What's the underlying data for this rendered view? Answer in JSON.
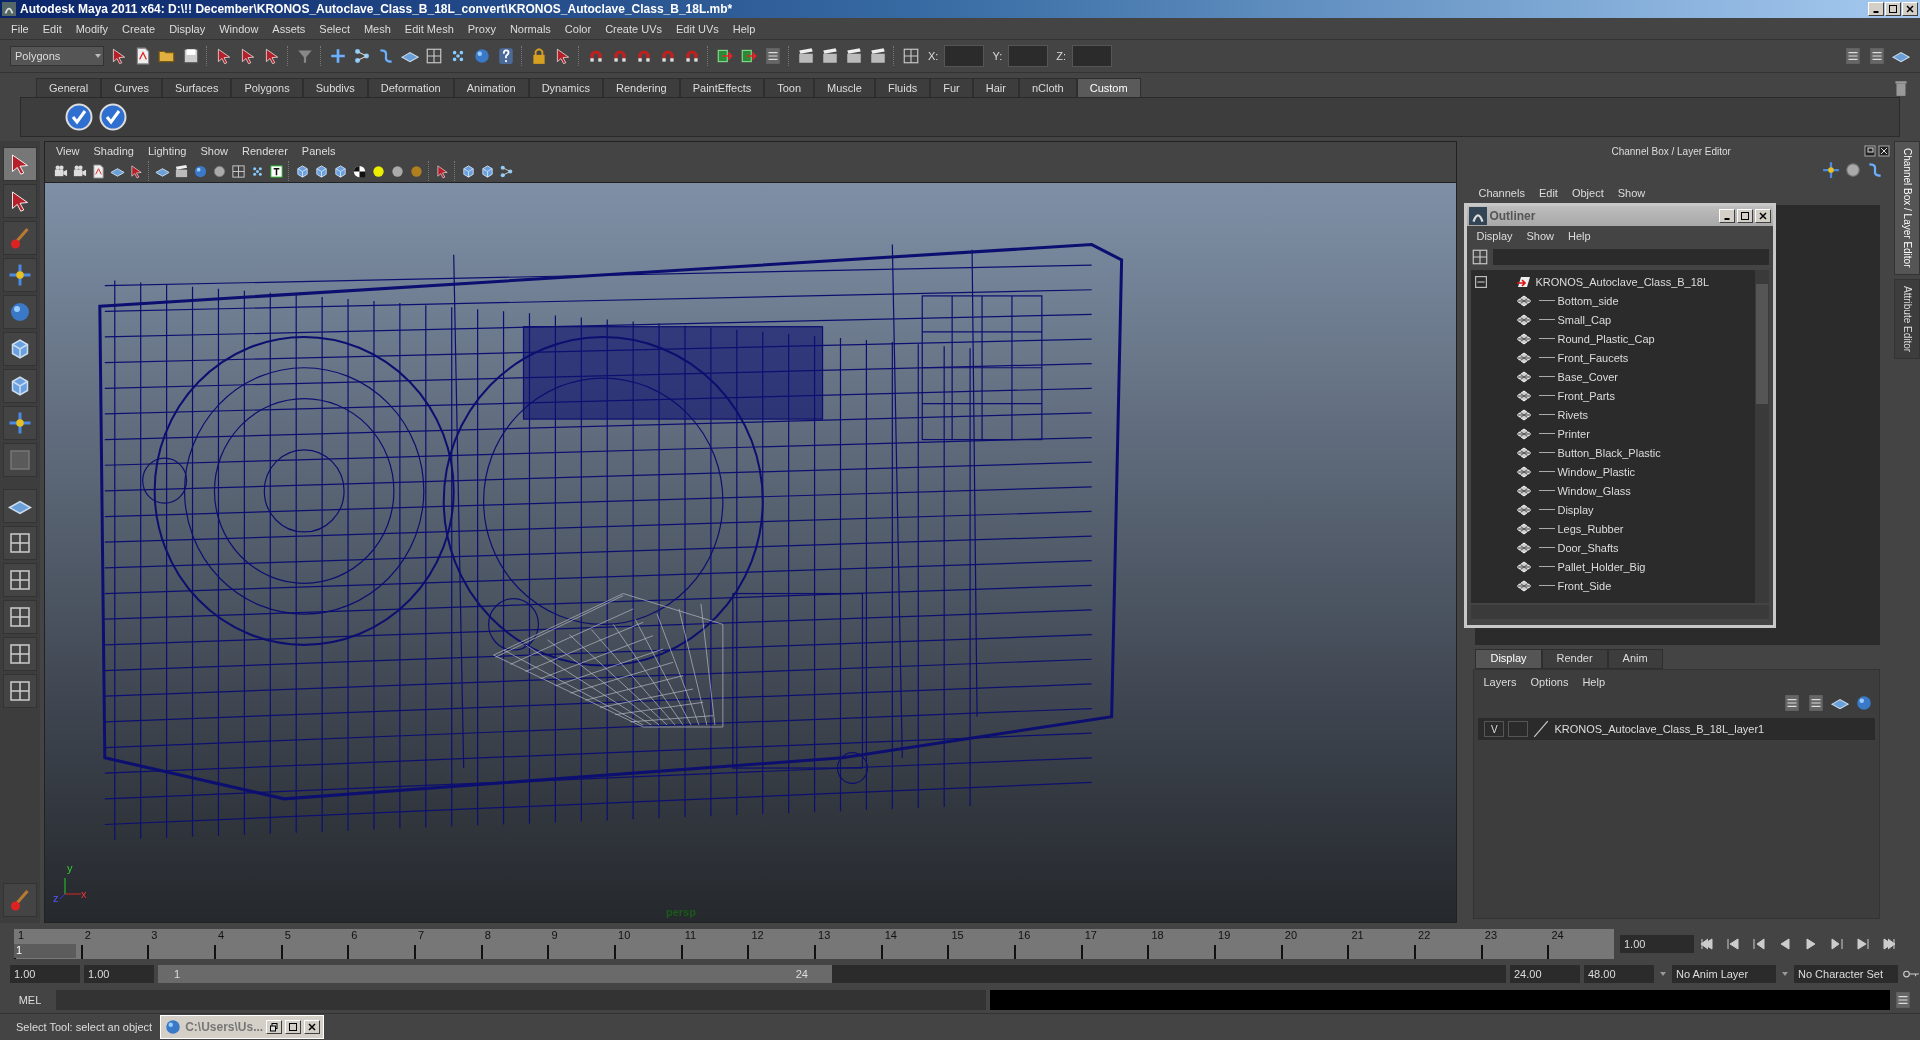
{
  "window": {
    "title": "Autodesk Maya 2011 x64: D:\\!! December\\KRONOS_Autoclave_Class_B_18L_convert\\KRONOS_Autoclave_Class_B_18L.mb*"
  },
  "menu_bar": [
    "File",
    "Edit",
    "Modify",
    "Create",
    "Display",
    "Window",
    "Assets",
    "Select",
    "Mesh",
    "Edit Mesh",
    "Proxy",
    "Normals",
    "Color",
    "Create UVs",
    "Edit UVs",
    "Help"
  ],
  "status_line": {
    "mode": "Polygons",
    "coordinate_labels": [
      "X:",
      "Y:",
      "Z:"
    ]
  },
  "shelf_tabs": [
    {
      "label": "General",
      "selected": false
    },
    {
      "label": "Curves",
      "selected": false
    },
    {
      "label": "Surfaces",
      "selected": false
    },
    {
      "label": "Polygons",
      "selected": false
    },
    {
      "label": "Subdivs",
      "selected": false
    },
    {
      "label": "Deformation",
      "selected": false
    },
    {
      "label": "Animation",
      "selected": false
    },
    {
      "label": "Dynamics",
      "selected": false
    },
    {
      "label": "Rendering",
      "selected": false
    },
    {
      "label": "PaintEffects",
      "selected": false
    },
    {
      "label": "Toon",
      "selected": false
    },
    {
      "label": "Muscle",
      "selected": false
    },
    {
      "label": "Fluids",
      "selected": false
    },
    {
      "label": "Fur",
      "selected": false
    },
    {
      "label": "Hair",
      "selected": false
    },
    {
      "label": "nCloth",
      "selected": false
    },
    {
      "label": "Custom",
      "selected": true
    }
  ],
  "viewport": {
    "menus": [
      "View",
      "Shading",
      "Lighting",
      "Show",
      "Renderer",
      "Panels"
    ],
    "camera": "persp",
    "axis_labels": [
      "y",
      "z",
      "x"
    ]
  },
  "channel_box": {
    "title": "Channel Box / Layer Editor",
    "menus": [
      "Channels",
      "Edit",
      "Object",
      "Show"
    ]
  },
  "side_tabs": [
    {
      "label": "Channel Box / Layer Editor",
      "selected": true
    },
    {
      "label": "Attribute Editor",
      "selected": false
    }
  ],
  "outliner": {
    "title": "Outliner",
    "menus": [
      "Display",
      "Show",
      "Help"
    ],
    "items": [
      {
        "name": "KRONOS_Autoclave_Class_B_18L",
        "kind": "group",
        "expanded": true,
        "children": [
          {
            "name": "Bottom_side",
            "kind": "mesh"
          },
          {
            "name": "Small_Cap",
            "kind": "mesh"
          },
          {
            "name": "Round_Plastic_Cap",
            "kind": "mesh"
          },
          {
            "name": "Front_Faucets",
            "kind": "mesh"
          },
          {
            "name": "Base_Cover",
            "kind": "mesh"
          },
          {
            "name": "Front_Parts",
            "kind": "mesh"
          },
          {
            "name": "Rivets",
            "kind": "mesh"
          },
          {
            "name": "Printer",
            "kind": "mesh"
          },
          {
            "name": "Button_Black_Plastic",
            "kind": "mesh"
          },
          {
            "name": "Window_Plastic",
            "kind": "mesh"
          },
          {
            "name": "Window_Glass",
            "kind": "mesh"
          },
          {
            "name": "Display",
            "kind": "mesh"
          },
          {
            "name": "Legs_Rubber",
            "kind": "mesh"
          },
          {
            "name": "Door_Shafts",
            "kind": "mesh"
          },
          {
            "name": "Pallet_Holder_Big",
            "kind": "mesh"
          },
          {
            "name": "Front_Side",
            "kind": "mesh"
          }
        ]
      }
    ]
  },
  "layer_editor": {
    "tabs": [
      {
        "label": "Display",
        "selected": true
      },
      {
        "label": "Render",
        "selected": false
      },
      {
        "label": "Anim",
        "selected": false
      }
    ],
    "menus": [
      "Layers",
      "Options",
      "Help"
    ],
    "layers": [
      {
        "visibility": "V",
        "name": "KRONOS_Autoclave_Class_B_18L_layer1"
      }
    ]
  },
  "time_slider": {
    "frames": [
      "1",
      "2",
      "3",
      "4",
      "5",
      "6",
      "7",
      "8",
      "9",
      "10",
      "11",
      "12",
      "13",
      "14",
      "15",
      "16",
      "17",
      "18",
      "19",
      "20",
      "21",
      "22",
      "23",
      "24"
    ],
    "current_frame": "1",
    "current_time": "1.00",
    "level": 0
  },
  "range_slider": {
    "level": 0.5,
    "start_time": "1.00",
    "playback_start": "1.00",
    "range_start": "1",
    "range_end": "24",
    "playback_end": "24.00",
    "end_time": "48.00",
    "anim_layer": "No Anim Layer",
    "character_set": "No Character Set"
  },
  "command_line": {
    "label": "MEL"
  },
  "help_line": "Select Tool: select an object",
  "minimized_window": {
    "title": "C:\\Users\\Us..."
  }
}
